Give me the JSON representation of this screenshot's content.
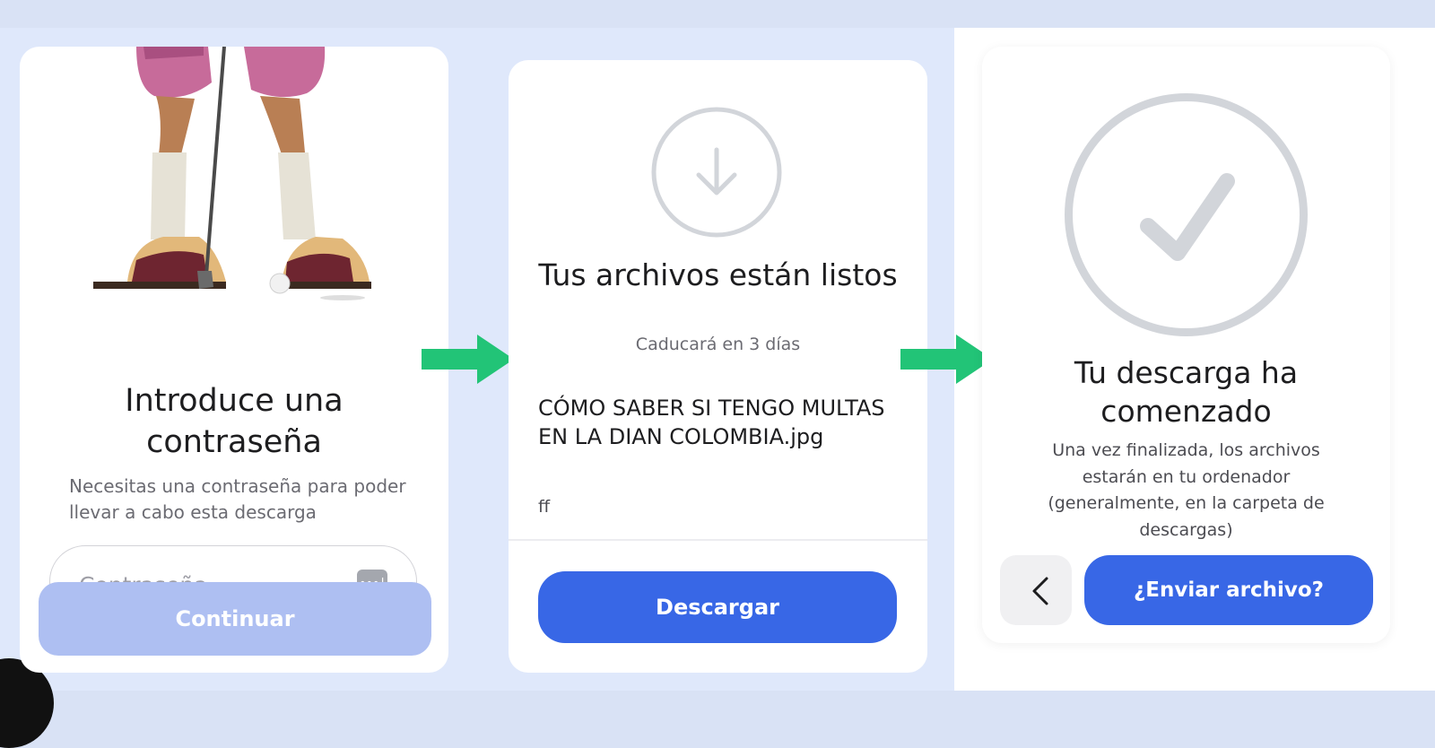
{
  "step1": {
    "title": "Introduce una contraseña",
    "subtitle": "Necesitas una contraseña para poder llevar a cabo esta descarga",
    "password_placeholder": "Contraseña",
    "continue_label": "Continuar"
  },
  "step2": {
    "title": "Tus archivos están listos",
    "expiry": "Caducará en 3 días",
    "file_name": "CÓMO SABER SI TENGO MULTAS EN LA DIAN COLOMBIA.jpg",
    "message": "ff",
    "download_label": "Descargar"
  },
  "step3": {
    "title": "Tu descarga ha comenzado",
    "description": "Una vez finalizada, los archivos estarán en tu ordenador (generalmente, en la carpeta de descargas)",
    "send_label": "¿Enviar archivo?"
  },
  "colors": {
    "primary": "#3867e6",
    "primary_disabled": "#aebff2",
    "arrow": "#22c477",
    "icon_gray": "#d2d5da",
    "background": "#dfe8fb"
  },
  "icons": [
    "key-icon",
    "download-arrow-icon",
    "checkmark-icon",
    "chevron-left-icon",
    "right-arrow-icon"
  ]
}
